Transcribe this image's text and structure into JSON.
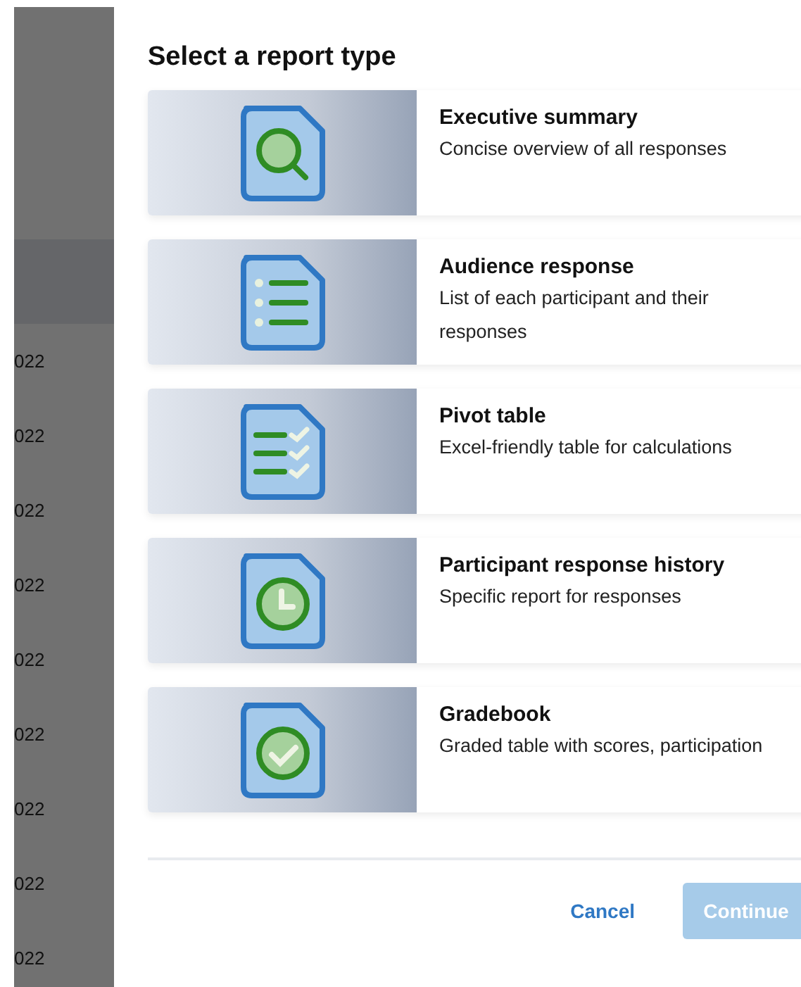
{
  "background": {
    "rows": [
      {
        "text": "022"
      },
      {
        "text": "022"
      },
      {
        "text": "022"
      },
      {
        "text": "022"
      },
      {
        "text": "022"
      },
      {
        "text": "022"
      },
      {
        "text": "022"
      },
      {
        "text": "022"
      },
      {
        "text": "022"
      }
    ]
  },
  "dialog": {
    "title": "Select a report type",
    "report_types": [
      {
        "kind": "search",
        "title": "Executive summary",
        "description": "Concise overview of all responses"
      },
      {
        "kind": "list",
        "title": "Audience response",
        "description": "List of each participant and their responses"
      },
      {
        "kind": "checklist",
        "title": "Pivot table",
        "description": "Excel-friendly table for calculations"
      },
      {
        "kind": "clock",
        "title": "Participant response history",
        "description": "Specific report for responses"
      },
      {
        "kind": "check",
        "title": "Gradebook",
        "description": "Graded table with scores, participation"
      }
    ],
    "buttons": {
      "cancel": {
        "label": "Cancel"
      },
      "continue": {
        "label": "Continue",
        "disabled": true
      }
    }
  }
}
